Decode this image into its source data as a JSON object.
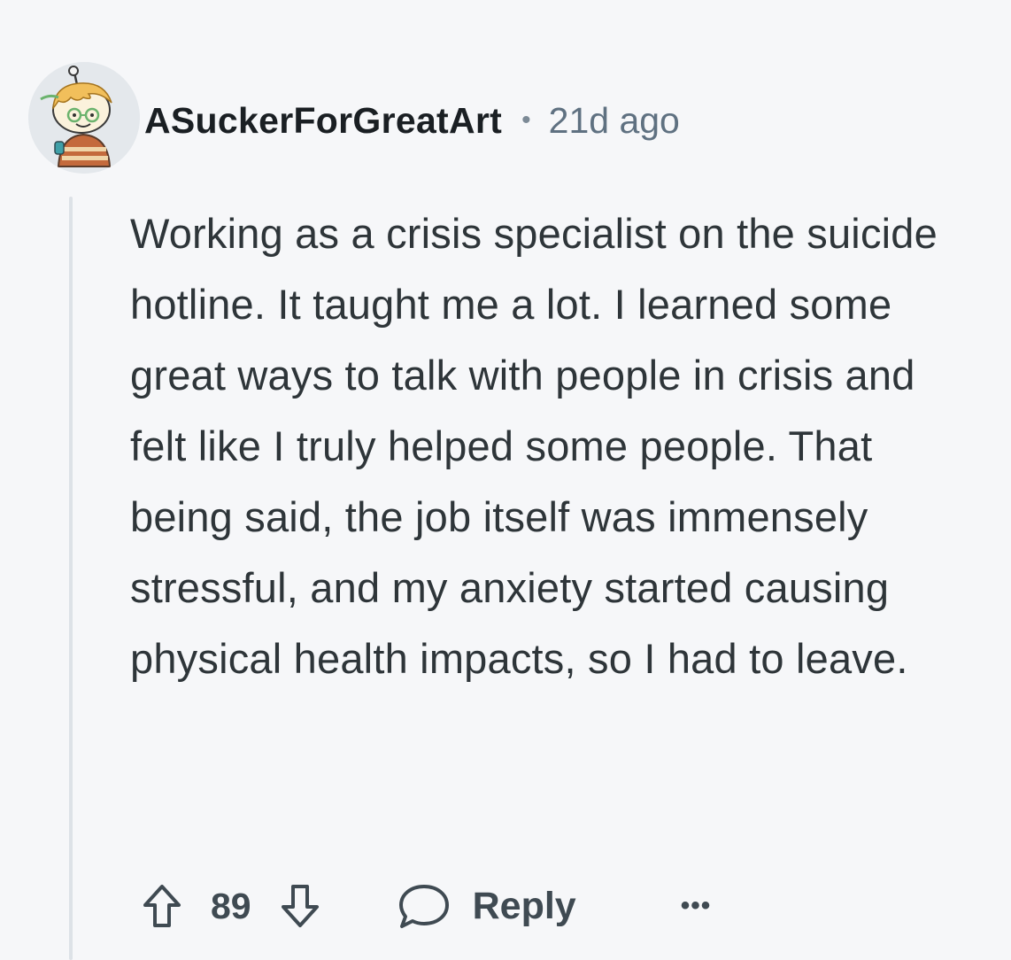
{
  "comment": {
    "username": "ASuckerForGreatArt",
    "separator": "•",
    "time_ago": "21d ago",
    "body": "Working as a crisis specialist on the suicide hotline. It taught me a lot. I learned some great ways to talk with people in crisis and felt like I truly helped some people. That being said, the job itself was immensely stressful, and my anxiety started causing physical health impacts, so I had to leave.",
    "avatar_icon": "user-avatar-snoo",
    "actions": {
      "upvote_icon": "upvote-arrow-icon",
      "vote_count": "89",
      "downvote_icon": "downvote-arrow-icon",
      "reply_icon": "speech-bubble-icon",
      "reply_label": "Reply",
      "more_label": "•••"
    }
  },
  "colors": {
    "background": "#f6f7f9",
    "username": "#1a1f23",
    "time": "#5f7181",
    "body_text": "#2e3539",
    "thread_line": "#dde2e7",
    "action_text": "#3f4a52"
  }
}
